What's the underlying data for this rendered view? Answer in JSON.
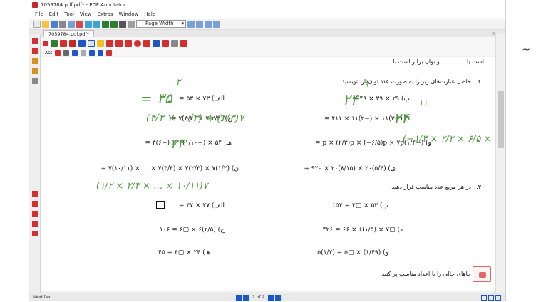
{
  "window": {
    "title": "7059784.pdf.pdf* - PDF Annotator"
  },
  "menu": [
    "File",
    "Edit",
    "Tool",
    "View",
    "Extras",
    "Window",
    "Help"
  ],
  "toolbar": {
    "zoom_value": "Page Width"
  },
  "tab": {
    "label": "7059784.pdf.pdf*",
    "close": "×"
  },
  "annot_small": {
    "label": "Ass"
  },
  "status": {
    "left": "Modified",
    "page_text": "1 of 2"
  },
  "side_mark": "~",
  "document": {
    "intro_line": "است با ............. و توان برابر است با ......................",
    "q2": {
      "number": "۲.",
      "text": "حاصل عبارت‌های زیر را به صورت عدد توان‌دار بنویسید."
    },
    "q2_items": {
      "alef": "الف) ۷۳ × ۵۳ =",
      "b": "ب) ۲۹ × ۳۹ × ۴۹ =",
      "j": "ج) (۲/۳)۷ × (۳/۴)۷ =",
      "d": "د) (−۳)۱۱ × (−۲)۱۱ × ۴۱۱ =",
      "h": "هـ) ۵۴ × (−۱/۱۰)۴ × (−۶)۴ =",
      "v": "و) (−۱/۴)p × (۲/۳)p × (−۶/۵)p × ۷p =",
      "n": "ن) (۱/۲)۷ × (۲/۳)۷ × (۳/۴)۷ × … × (۱۰/۱۱)۷ =",
      "y": "ی) (۵/۴)۲۰ × (۸/۱۵)۲۰ × ۹۲۰ ="
    },
    "q3": {
      "number": "۳.",
      "text": "در هر مربع عدد مناسب قرار دهید."
    },
    "q3_items": {
      "alef": "الف) ۲۷ × ۳۷ =",
      "b": "ب) ۵۳ × ▢۳ = ۱۵۳",
      "j": "ج) (۲/۵)۶ × ▢۶ = ۱۰۶",
      "d": "د) ▢۷ × (۱/۵)۶ × ۶۶ = ۴۲۶",
      "h": "هـ) ۲۴ × ▢۴ = ۴۵",
      "v": "و) (۱/۴۹) × ▢۵ = (۱/۷)۵"
    },
    "q4": {
      "number": "۴.",
      "text": "جاهای خالی را با اعداد مناسب پر کنید."
    }
  },
  "handwriting": {
    "h_alef": "= ۳۵",
    "h_alef_sup": "۳",
    "h_alef_frac": "(۴/۲ × ۱۰/۳) = (۴/۳)۷",
    "h_b": "۲۴",
    "h_b_sup": "۹",
    "h_d": "۲۴",
    "h_d_sup": "۱۱",
    "h_h": "۳۴",
    "h_v": "(−۱/۴ × ۲/۳ × ۶/۵ × ۷) = ۷p",
    "h_n": "(۱/۲ × ۲/۳ × … × ۱۰/۱۱)۷"
  },
  "colors": {
    "accent": "#1e56c8",
    "ink": "#4a9a3a",
    "pen_red": "#d32f2f"
  }
}
